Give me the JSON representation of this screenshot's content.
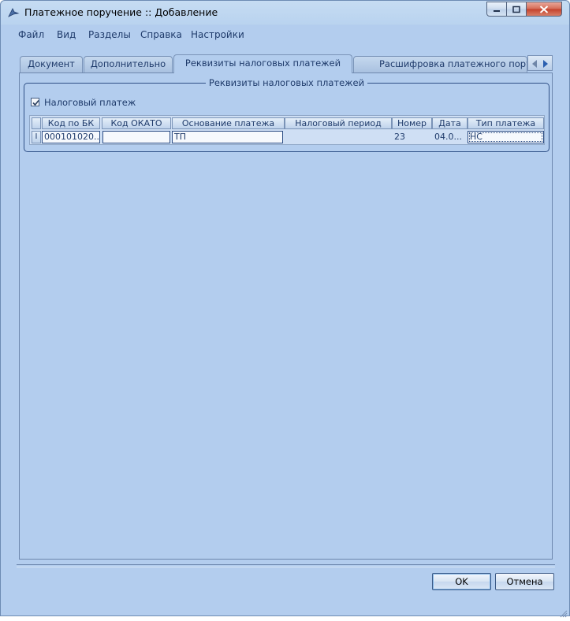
{
  "window": {
    "title": "Платежное поручение :: Добавление"
  },
  "menu": [
    {
      "label": "Файл"
    },
    {
      "label": "Вид"
    },
    {
      "label": "Разделы"
    },
    {
      "label": "Справка"
    },
    {
      "label": "Настройки"
    }
  ],
  "tabs": [
    {
      "label": "Документ",
      "active": false
    },
    {
      "label": "Дополнительно",
      "active": false
    },
    {
      "label": "Реквизиты налоговых платежей",
      "active": true
    },
    {
      "label": "Расшифровка платежного поручения",
      "active": false
    }
  ],
  "group": {
    "title": "Реквизиты налоговых платежей",
    "tax_payment_checkbox": {
      "label": "Налоговый платеж",
      "checked": true
    }
  },
  "grid": {
    "columns": [
      "Код по БК",
      "Код ОКАТО",
      "Основание платежа",
      "Налоговый период",
      "Номер",
      "Дата",
      "Тип платежа"
    ],
    "rows": [
      {
        "indicator": "I",
        "cells": [
          "000101020...",
          "",
          "ТП",
          "",
          "23",
          "04.0...",
          "НС"
        ]
      }
    ]
  },
  "buttons": {
    "ok": "OK",
    "cancel": "Отмена"
  },
  "colors": {
    "window_bg": "#b3cdee",
    "text": "#1f3b6b",
    "border": "#2e4f86",
    "close_button": "#c4402a"
  }
}
